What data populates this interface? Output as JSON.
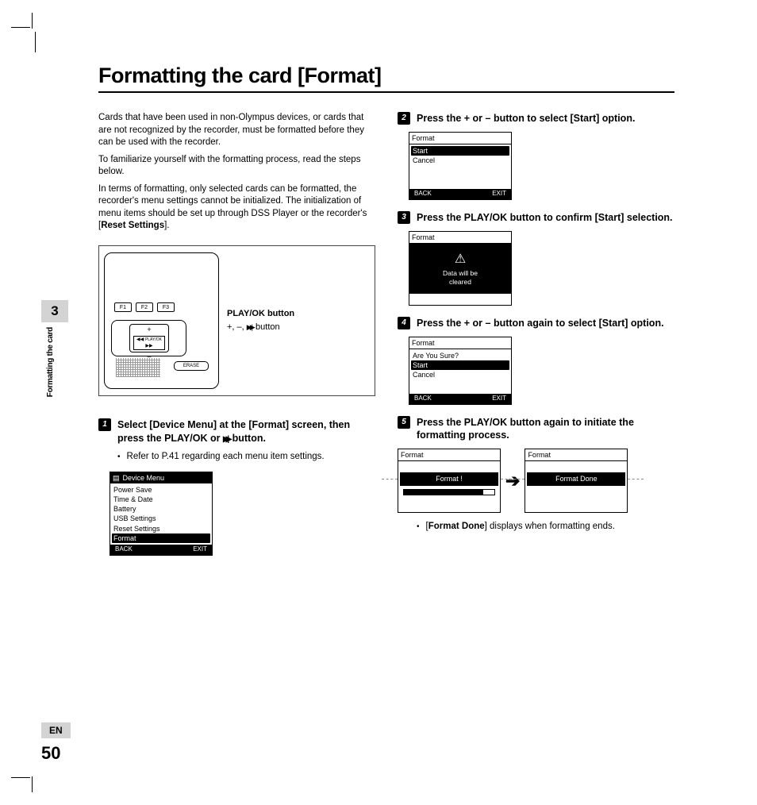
{
  "title": "Formatting the card [Format]",
  "intro": {
    "p1": "Cards that have been used in non-Olympus devices, or cards that are not recognized by the recorder, must be formatted before they can be used with the recorder.",
    "p2": "To familiarize yourself with the formatting process, read the steps below.",
    "p3a": "In terms of formatting, only selected cards can be formatted, the recorder's menu settings cannot be initialized. The initialization of menu items should be set up through DSS Player or the recorder's [",
    "p3b": "Reset Settings",
    "p3c": "]."
  },
  "diagram": {
    "f1": "F1",
    "f2": "F2",
    "f3": "F3",
    "playok": "PLAY/OK",
    "erase": "ERASE",
    "label1": "PLAY/OK button",
    "label2_prefix": "+, –, ",
    "label2_suffix": " button"
  },
  "steps": {
    "s1": {
      "num": "1",
      "text_a": "Select [",
      "text_b": "Device Menu",
      "text_c": "] at the [",
      "text_d": "Format",
      "text_e": "] screen, then press the ",
      "text_f": "PLAY/OK",
      "text_g": " or ",
      "text_h": " button.",
      "sub": "Refer to P.41 regarding each menu item settings.",
      "lcd": {
        "title": "Device Menu",
        "items": [
          "Power Save",
          "Time & Date",
          "Battery",
          "USB Settings",
          "Reset Settings",
          "Format"
        ],
        "back": "BACK",
        "exit": "EXIT"
      }
    },
    "s2": {
      "num": "2",
      "text_a": "Press the ",
      "text_b": "+",
      "text_c": " or ",
      "text_d": "–",
      "text_e": " button to select [",
      "text_f": "Start",
      "text_g": "] option.",
      "lcd": {
        "title": "Format",
        "items": [
          "Start",
          "Cancel"
        ],
        "back": "BACK",
        "exit": "EXIT"
      }
    },
    "s3": {
      "num": "3",
      "text_a": "Press the ",
      "text_b": "PLAY/OK",
      "text_c": " button to confirm [",
      "text_d": "Start",
      "text_e": "] selection.",
      "lcd": {
        "title": "Format",
        "warn": "Data will be\ncleared"
      }
    },
    "s4": {
      "num": "4",
      "text_a": "Press the ",
      "text_b": "+",
      "text_c": " or ",
      "text_d": "–",
      "text_e": " button again to select [",
      "text_f": "Start",
      "text_g": "] option.",
      "lcd": {
        "title": "Format",
        "prompt": "Are You Sure?",
        "items": [
          "Start",
          "Cancel"
        ],
        "back": "BACK",
        "exit": "EXIT"
      }
    },
    "s5": {
      "num": "5",
      "text_a": "Press the ",
      "text_b": "PLAY/OK",
      "text_c": " button again to initiate the formatting process.",
      "lcd1": {
        "title": "Format",
        "status": "Format !"
      },
      "lcd2": {
        "title": "Format",
        "status": "Format Done"
      },
      "sub_a": "[",
      "sub_b": "Format Done",
      "sub_c": "] displays when formatting ends."
    }
  },
  "sidebar": {
    "chapter": "3",
    "label": "Formatting the card"
  },
  "footer": {
    "lang": "EN",
    "page": "50"
  }
}
